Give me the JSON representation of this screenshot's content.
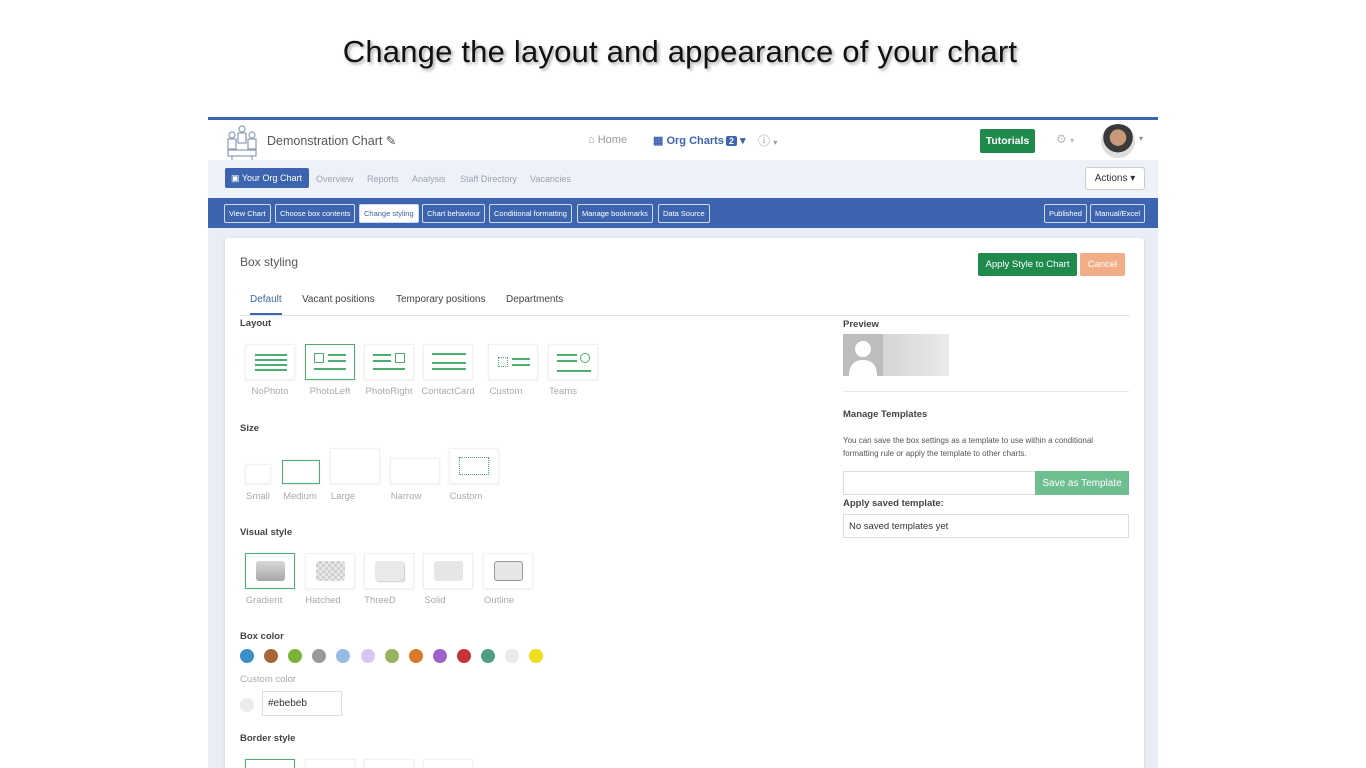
{
  "slide": {
    "title": "Change the layout and appearance of your chart"
  },
  "topbar": {
    "app_title": "Demonstration Chart",
    "edit_icon": "pencil-icon",
    "home_label": "Home",
    "org_charts_label": "Org Charts",
    "org_charts_count": "2",
    "help_icon": "question-circle-icon",
    "tutorials_label": "Tutorials",
    "settings_icon": "gear-icon"
  },
  "tabs": {
    "active": "Your Org Chart",
    "items": [
      "Overview",
      "Reports",
      "Analysis",
      "Staff Directory",
      "Vacancies"
    ],
    "actions_label": "Actions"
  },
  "subnav": {
    "items": [
      "View Chart",
      "Choose box contents",
      "Change styling",
      "Chart behaviour",
      "Conditional formatting",
      "Manage bookmarks",
      "Data Source"
    ],
    "active": "Change styling",
    "right": [
      "Published",
      "Manual/Excel"
    ]
  },
  "card": {
    "title": "Box styling",
    "apply_label": "Apply Style to Chart",
    "cancel_label": "Cancel",
    "subtabs": [
      "Default",
      "Vacant positions",
      "Temporary positions",
      "Departments"
    ],
    "active_subtab": "Default"
  },
  "layout": {
    "label": "Layout",
    "options": [
      "NoPhoto",
      "PhotoLeft",
      "PhotoRight",
      "ContactCard",
      "Custom",
      "Teams"
    ],
    "selected": "PhotoLeft"
  },
  "size": {
    "label": "Size",
    "options": [
      "Small",
      "Medium",
      "Large",
      "Narrow",
      "Custom"
    ],
    "selected": "Medium"
  },
  "visual_style": {
    "label": "Visual style",
    "options": [
      "Gradient",
      "Hatched",
      "ThreeD",
      "Solid",
      "Outline"
    ],
    "selected": "Gradient"
  },
  "box_color": {
    "label": "Box color",
    "swatches": [
      "#3c8fc7",
      "#a8653a",
      "#7bb23a",
      "#999999",
      "#95bde4",
      "#dcc6f0",
      "#97b45d",
      "#d87a2a",
      "#9b62c9",
      "#c8323a",
      "#4c9f80",
      "#ebebeb",
      "#f2da1e"
    ],
    "custom_label": "Custom color",
    "custom_value": "#ebebeb"
  },
  "border_style": {
    "label": "Border style"
  },
  "preview": {
    "label": "Preview"
  },
  "templates": {
    "label": "Manage Templates",
    "description": "You can save the box settings as a template to use within a conditional formatting rule or apply the template to other charts.",
    "save_label": "Save as Template",
    "apply_label": "Apply saved template:",
    "select_value": "No saved templates yet"
  }
}
